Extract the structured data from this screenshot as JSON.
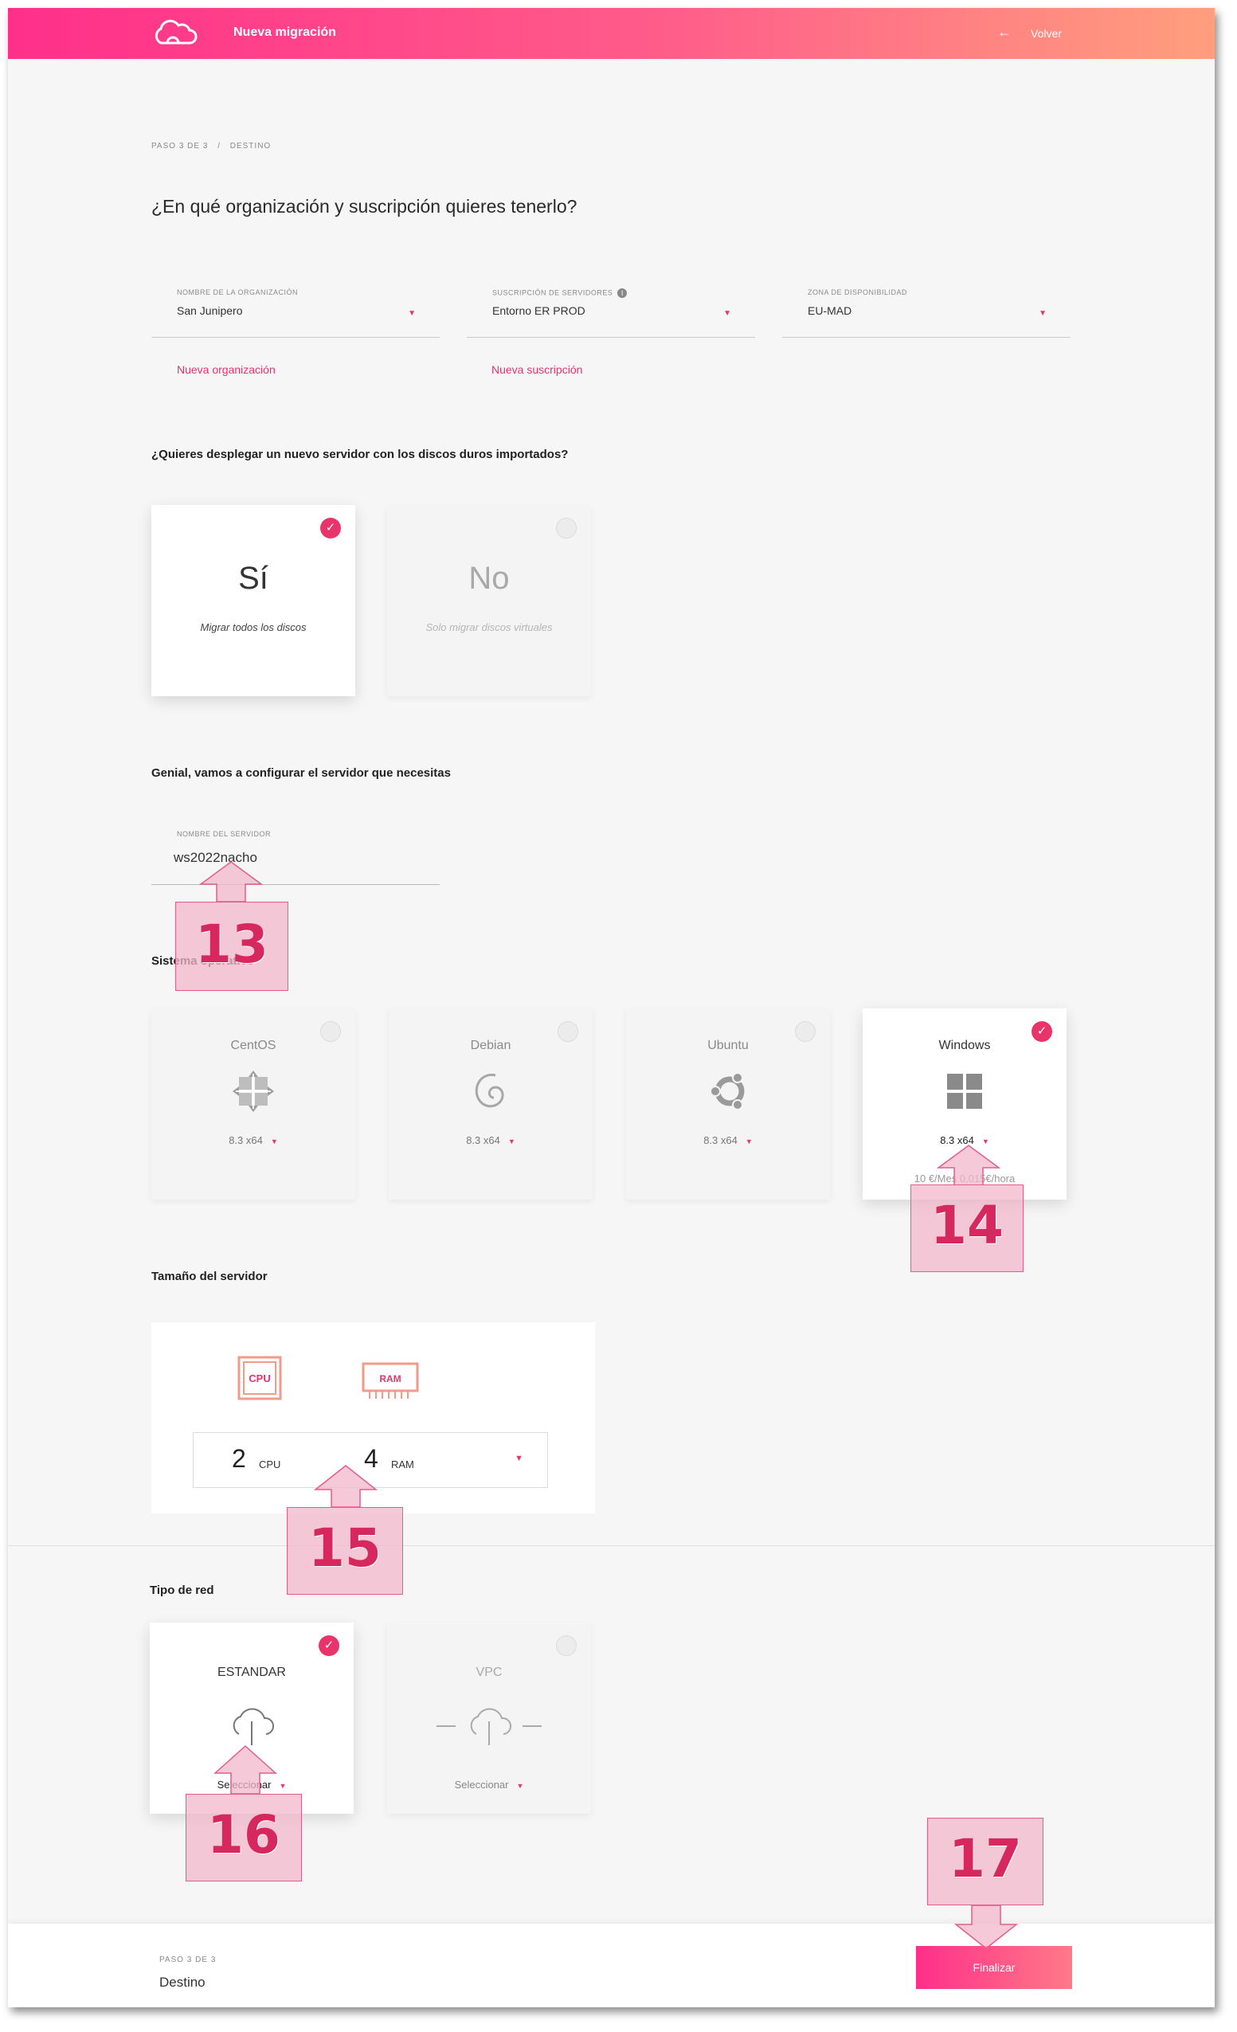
{
  "header": {
    "title": "Nueva migración",
    "back_label": "Volver",
    "back_arrow": "←"
  },
  "breadcrumb": {
    "step": "PASO 3 DE 3",
    "sep": "/",
    "current": "DESTINO"
  },
  "page_title": "¿En qué organización y suscripción quieres tenerlo?",
  "fields": {
    "org": {
      "label": "NOMBRE DE LA ORGANIZACIÓN",
      "value": "San Junipero"
    },
    "sub": {
      "label": "SUSCRIPCIÓN DE SERVIDORES",
      "value": "Entorno ER PROD",
      "info": "i"
    },
    "zone": {
      "label": "ZONA DE DISPONIBILIDAD",
      "value": "EU-MAD"
    }
  },
  "links": {
    "new_org": "Nueva organización",
    "new_sub": "Nueva suscripción"
  },
  "deploy": {
    "question": "¿Quieres desplegar un nuevo servidor con los discos duros importados?",
    "yes": {
      "title": "Sí",
      "sub": "Migrar todos los discos",
      "selected": true
    },
    "no": {
      "title": "No",
      "sub": "Solo migrar discos virtuales",
      "selected": false
    }
  },
  "config_title": "Genial, vamos a configurar el servidor que necesitas",
  "server_name": {
    "label": "NOMBRE DEL SERVIDOR",
    "value": "ws2022nacho"
  },
  "os": {
    "title": "Sistema operativo",
    "items": [
      {
        "name": "CentOS",
        "version": "8.3 x64",
        "selected": false,
        "icon": "centos-icon"
      },
      {
        "name": "Debian",
        "version": "8.3 x64",
        "selected": false,
        "icon": "debian-icon"
      },
      {
        "name": "Ubuntu",
        "version": "8.3 x64",
        "selected": false,
        "icon": "ubuntu-icon"
      },
      {
        "name": "Windows",
        "version": "8.3 x64",
        "selected": true,
        "icon": "windows-icon",
        "price": "10 €/Mes   0,015€/hora"
      }
    ]
  },
  "size": {
    "title": "Tamaño del servidor",
    "cpu_icon": "CPU",
    "ram_icon": "RAM",
    "cpu": "2",
    "cpu_unit": "CPU",
    "ram": "4",
    "ram_unit": "RAM"
  },
  "network": {
    "title": "Tipo de red",
    "items": [
      {
        "name": "ESTANDAR",
        "select": "Seleccionar",
        "selected": true
      },
      {
        "name": "VPC",
        "select": "Seleccionar",
        "selected": false
      }
    ]
  },
  "footer": {
    "step": "PASO 3 DE 3",
    "destination": "Destino",
    "finish": "Finalizar"
  },
  "annotations": [
    "13",
    "14",
    "15",
    "16",
    "17"
  ],
  "colors": {
    "accent": "#e8336b",
    "gradient_start": "#ff2f8a",
    "gradient_end": "#ff9f7d"
  }
}
